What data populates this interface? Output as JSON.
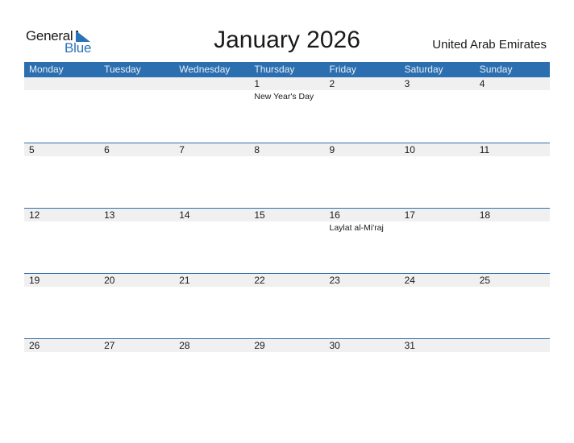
{
  "logo": {
    "general": "General",
    "blue": "Blue"
  },
  "title": "January 2026",
  "country": "United Arab Emirates",
  "weekdays": [
    "Monday",
    "Tuesday",
    "Wednesday",
    "Thursday",
    "Friday",
    "Saturday",
    "Sunday"
  ],
  "weeks": [
    {
      "days": [
        "",
        "",
        "",
        "1",
        "2",
        "3",
        "4"
      ],
      "events": [
        "",
        "",
        "",
        "New Year's Day",
        "",
        "",
        ""
      ]
    },
    {
      "days": [
        "5",
        "6",
        "7",
        "8",
        "9",
        "10",
        "11"
      ],
      "events": [
        "",
        "",
        "",
        "",
        "",
        "",
        ""
      ]
    },
    {
      "days": [
        "12",
        "13",
        "14",
        "15",
        "16",
        "17",
        "18"
      ],
      "events": [
        "",
        "",
        "",
        "",
        "Laylat al-Mi'raj",
        "",
        ""
      ]
    },
    {
      "days": [
        "19",
        "20",
        "21",
        "22",
        "23",
        "24",
        "25"
      ],
      "events": [
        "",
        "",
        "",
        "",
        "",
        "",
        ""
      ]
    },
    {
      "days": [
        "26",
        "27",
        "28",
        "29",
        "30",
        "31",
        ""
      ],
      "events": [
        "",
        "",
        "",
        "",
        "",
        "",
        ""
      ]
    }
  ],
  "colors": {
    "accent": "#2c6fb0",
    "datebar": "#f0f0f0",
    "logo_blue": "#2a73b8"
  }
}
